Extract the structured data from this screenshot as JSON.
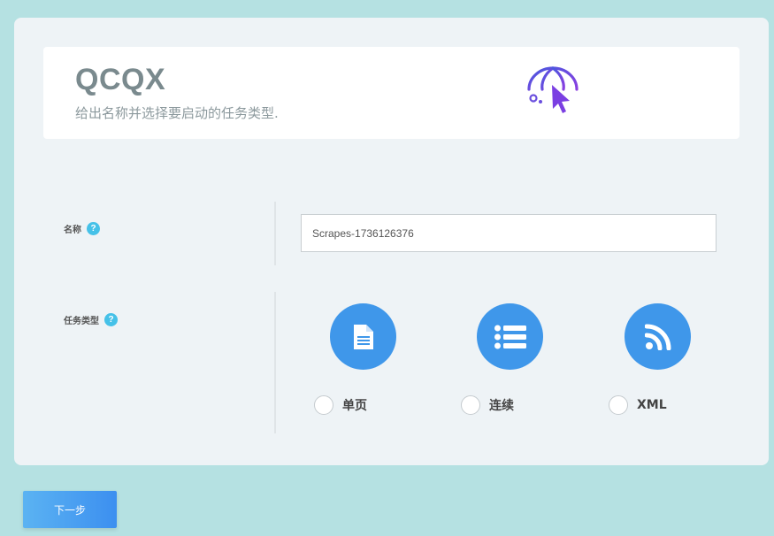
{
  "header": {
    "title": "QCQX",
    "subtitle": "给出名称并选择要启动的任务类型.",
    "icon": "globe-cursor-icon"
  },
  "form": {
    "name": {
      "label": "名称",
      "help": "?",
      "value": "Scrapes-1736126376"
    },
    "task_type": {
      "label": "任务类型",
      "help": "?",
      "options": [
        {
          "icon": "document-icon",
          "label": "单页",
          "selected": false
        },
        {
          "icon": "list-icon",
          "label": "连续",
          "selected": false
        },
        {
          "icon": "rss-icon",
          "label": "XML",
          "selected": false
        }
      ]
    }
  },
  "footer": {
    "next_label": "下一步"
  },
  "colors": {
    "background": "#b5e1e2",
    "card": "#eef3f6",
    "accent_blue": "#3f97ea",
    "help_blue": "#45c1e8",
    "icon_purple": "#5b4fd8"
  }
}
